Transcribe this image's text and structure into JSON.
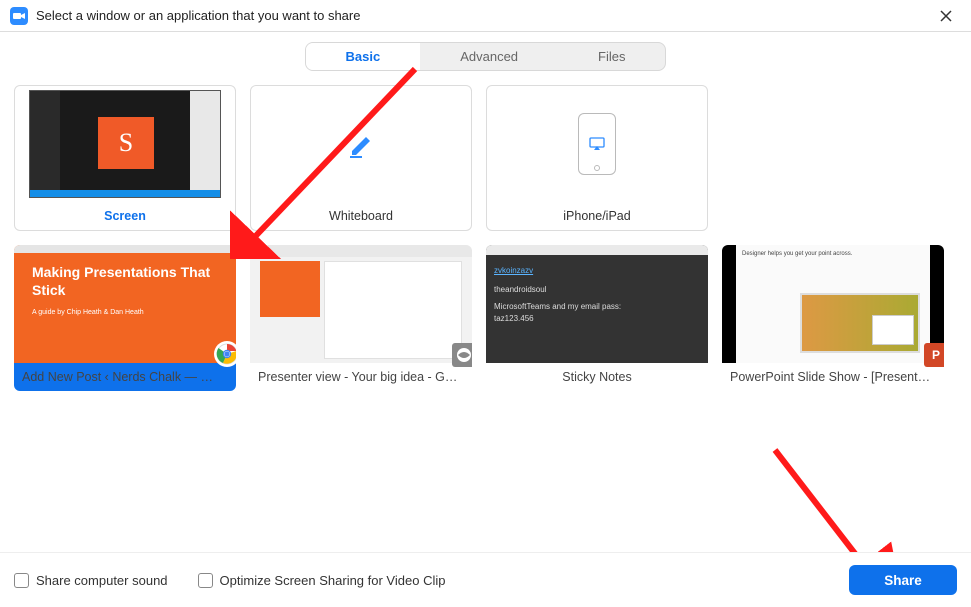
{
  "titlebar": {
    "title": "Select a window or an application that you want to share"
  },
  "tabs": {
    "basic": "Basic",
    "advanced": "Advanced",
    "files": "Files"
  },
  "tiles": {
    "screen": "Screen",
    "whiteboard": "Whiteboard",
    "iphone": "iPhone/iPad"
  },
  "sources": [
    {
      "label": "Add New Post ‹ Nerds Chalk — …",
      "icon": "chrome",
      "preview": "chrome_slide"
    },
    {
      "label": "Presenter view - Your big idea - G…",
      "icon": "grey",
      "preview": "presenter"
    },
    {
      "label": "Sticky Notes",
      "icon": "",
      "preview": "sticky"
    },
    {
      "label": "PowerPoint Slide Show - [Present…",
      "icon": "ppt",
      "preview": "ppt"
    }
  ],
  "chrome_slide": {
    "heading": "Making Presentations That Stick",
    "sub": "A guide by Chip Heath & Dan Heath"
  },
  "sticky": {
    "link": "zvkoinzazv",
    "line1": "theandroidsoul",
    "line2": "MicrosoftTeams and my email pass:",
    "line3": "taz123.456"
  },
  "ppt_preview": {
    "title": "Designer helps you get your point across."
  },
  "footer": {
    "share_sound": "Share computer sound",
    "optimize": "Optimize Screen Sharing for Video Clip",
    "share_btn": "Share"
  },
  "screen_letter": "S",
  "ppt_badge": "P"
}
